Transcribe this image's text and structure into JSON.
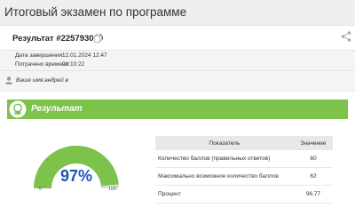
{
  "header": {
    "title": "Итоговый экзамен по программе"
  },
  "result": {
    "title": "Результат #225793080"
  },
  "meta": {
    "completed_label": "Дата завершения:",
    "completed_value": "12.01.2024 12:47",
    "spent_label": "Потрачено времени:",
    "spent_value": "00:10:22"
  },
  "user": {
    "text": "Ваше имя:андрей в"
  },
  "banner": {
    "title": "Результат",
    "color": "#7dc24b"
  },
  "gauge": {
    "value": 97,
    "value_label": "97%",
    "min_label": "0",
    "max_label": "100",
    "fill_color": "#7dc24b",
    "track_color": "#dddddd"
  },
  "stats": {
    "col_indicator": "Показатель",
    "col_value": "Значение",
    "rows": [
      {
        "label": "Количество баллов (правильных ответов)",
        "value": "60"
      },
      {
        "label": "Максимально возможное количество баллов",
        "value": "62"
      },
      {
        "label": "Процент",
        "value": "96.77"
      }
    ]
  }
}
